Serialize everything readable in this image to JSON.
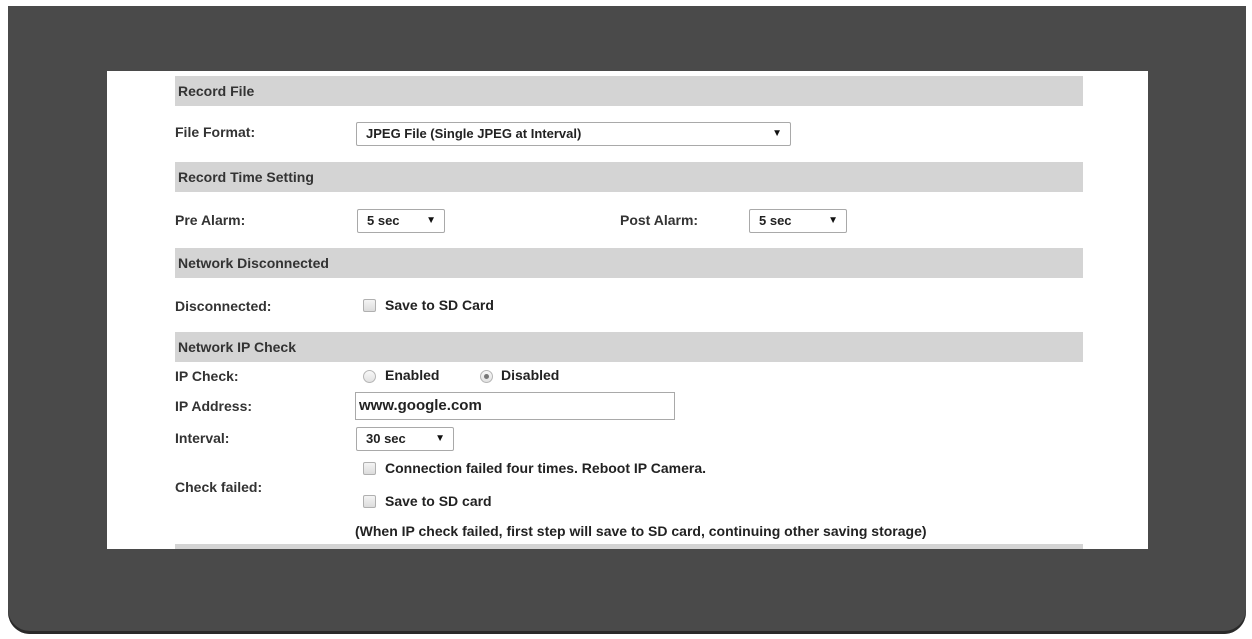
{
  "record_file": {
    "heading": "Record File",
    "file_format_label": "File Format:",
    "file_format_value": "JPEG File (Single JPEG at Interval)"
  },
  "record_time": {
    "heading": "Record Time Setting",
    "pre_alarm_label": "Pre Alarm:",
    "pre_alarm_value": "5 sec",
    "post_alarm_label": "Post Alarm:",
    "post_alarm_value": "5 sec"
  },
  "network_disconnected": {
    "heading": "Network Disconnected",
    "disconnected_label": "Disconnected:",
    "save_sd_label": "Save to SD Card",
    "save_sd_checked": false
  },
  "network_ip_check": {
    "heading": "Network IP Check",
    "ip_check_label": "IP Check:",
    "enabled_label": "Enabled",
    "disabled_label": "Disabled",
    "selected": "Disabled",
    "ip_address_label": "IP Address:",
    "ip_address_value": "www.google.com",
    "interval_label": "Interval:",
    "interval_value": "30 sec",
    "check_failed_label": "Check failed:",
    "reboot_label": "Connection failed four times. Reboot IP Camera.",
    "reboot_checked": false,
    "save_sd_label": "Save to SD card",
    "save_sd_checked": false,
    "note": "(When IP check failed, first step will save to SD card, continuing other saving storage)"
  },
  "icons": {
    "dropdown_arrow": "▼"
  }
}
